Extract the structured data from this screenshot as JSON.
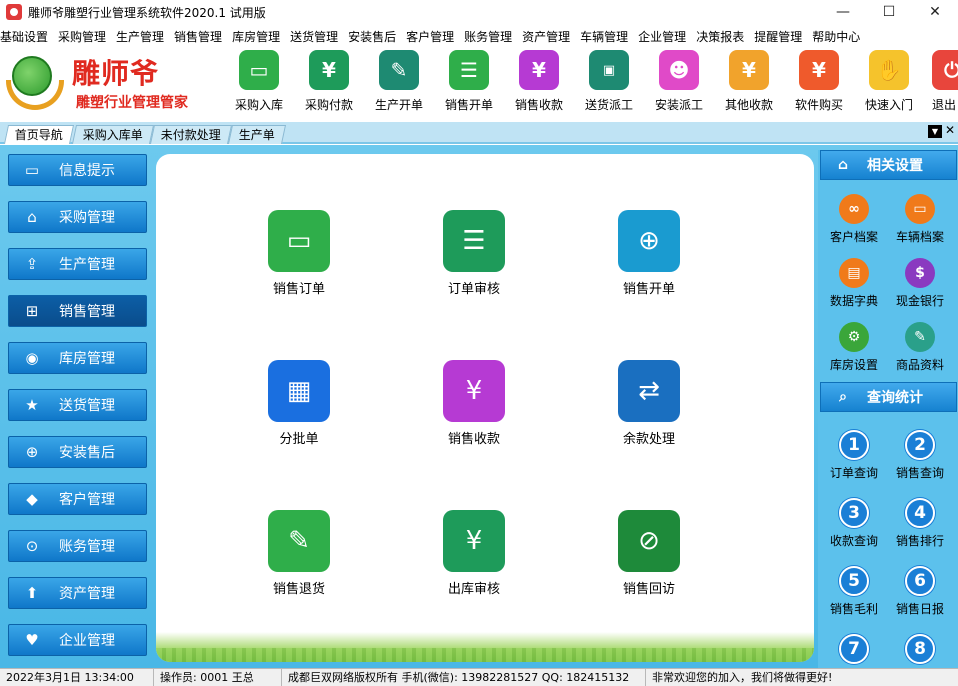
{
  "window": {
    "title": "雕师爷雕塑行业管理系统软件2020.1 试用版",
    "controls": {
      "minimize": "—",
      "maximize": "☐",
      "close": "✕"
    }
  },
  "menu": [
    "基础设置",
    "采购管理",
    "生产管理",
    "销售管理",
    "库房管理",
    "送货管理",
    "安装售后",
    "客户管理",
    "账务管理",
    "资产管理",
    "车辆管理",
    "企业管理",
    "决策报表",
    "提醒管理",
    "帮助中心"
  ],
  "logo": {
    "title": "雕师爷",
    "subtitle": "雕塑行业管理管家"
  },
  "toolbar": [
    {
      "label": "采购入库",
      "icon": "folder-icon",
      "color": "#2fae4a"
    },
    {
      "label": "采购付款",
      "icon": "scan-yen-icon",
      "color": "#1e9b5a"
    },
    {
      "label": "生产开单",
      "icon": "clipboard-pen-icon",
      "color": "#1e8a72"
    },
    {
      "label": "销售开单",
      "icon": "cart-form-icon",
      "color": "#2fae4a"
    },
    {
      "label": "销售收款",
      "icon": "receipt-yen-icon",
      "color": "#b63ad3"
    },
    {
      "label": "送货派工",
      "icon": "delivery-truck-icon",
      "color": "#1e8a72"
    },
    {
      "label": "安装派工",
      "icon": "people-icon",
      "color": "#e04ac8"
    },
    {
      "label": "其他收款",
      "icon": "money-bag-icon",
      "color": "#f1a32c"
    },
    {
      "label": "软件购买",
      "icon": "buy-yen-icon",
      "color": "#ef5a2c"
    },
    {
      "label": "快速入门",
      "icon": "hand-icon",
      "color": "#f5c32c"
    },
    {
      "label": "退出",
      "icon": "exit-icon",
      "color": "#e8453c"
    }
  ],
  "tabs": [
    "首页导航",
    "采购入库单",
    "未付款处理",
    "生产单"
  ],
  "leftnav": [
    {
      "label": "信息提示",
      "icon": "monitor-icon"
    },
    {
      "label": "采购管理",
      "icon": "home-icon"
    },
    {
      "label": "生产管理",
      "icon": "upload-box-icon"
    },
    {
      "label": "销售管理",
      "icon": "cart-icon"
    },
    {
      "label": "库房管理",
      "icon": "eye-icon"
    },
    {
      "label": "送货管理",
      "icon": "star-icon"
    },
    {
      "label": "安装售后",
      "icon": "target-icon"
    },
    {
      "label": "客户管理",
      "icon": "tag-icon"
    },
    {
      "label": "账务管理",
      "icon": "circle-plus-icon"
    },
    {
      "label": "资产管理",
      "icon": "upload-icon"
    },
    {
      "label": "企业管理",
      "icon": "heart-icon"
    }
  ],
  "center": [
    {
      "label": "销售订单",
      "icon": "folder-icon",
      "color": "#2fae4a"
    },
    {
      "label": "订单审核",
      "icon": "document-check-icon",
      "color": "#1e9b5a"
    },
    {
      "label": "销售开单",
      "icon": "sale-document-icon",
      "color": "#1a9bd0"
    },
    {
      "label": "分批单",
      "icon": "calendar-icon",
      "color": "#1a6fe0"
    },
    {
      "label": "销售收款",
      "icon": "receipt-yen-icon",
      "color": "#b63ad3"
    },
    {
      "label": "余款处理",
      "icon": "exchange-icon",
      "color": "#1a6fc0"
    },
    {
      "label": "销售退货",
      "icon": "edit-icon",
      "color": "#2fae4a"
    },
    {
      "label": "出库审核",
      "icon": "scan-yen-icon",
      "color": "#1e9b5a"
    },
    {
      "label": "销售回访",
      "icon": "pen-circle-icon",
      "color": "#1e8a3a"
    }
  ],
  "right": {
    "settings_title": "相关设置",
    "settings": [
      {
        "label": "客户档案",
        "icon": "link-icon",
        "color": "#f07a1a"
      },
      {
        "label": "车辆档案",
        "icon": "monitor-icon",
        "color": "#f07a1a"
      },
      {
        "label": "数据字典",
        "icon": "book-icon",
        "color": "#f07a1a"
      },
      {
        "label": "现金银行",
        "icon": "bank-icon",
        "color": "#8a3ac0"
      },
      {
        "label": "库房设置",
        "icon": "gear-icon",
        "color": "#3aa63a"
      },
      {
        "label": "商品资料",
        "icon": "pencil-icon",
        "color": "#2aa08a"
      }
    ],
    "stats_title": "查询统计",
    "stats": [
      {
        "num": "1",
        "label": "订单查询"
      },
      {
        "num": "2",
        "label": "销售查询"
      },
      {
        "num": "3",
        "label": "收款查询"
      },
      {
        "num": "4",
        "label": "销售排行"
      },
      {
        "num": "5",
        "label": "销售毛利"
      },
      {
        "num": "6",
        "label": "销售日报"
      },
      {
        "num": "7",
        "label": ""
      },
      {
        "num": "8",
        "label": ""
      }
    ]
  },
  "status": {
    "datetime": "2022年3月1日 13:34:00",
    "operator": "操作员: 0001 王总",
    "copyright": "成都巨双网络版权所有 手机(微信): 13982281527 QQ: 182415132",
    "message": "非常欢迎您的加入，我们将做得更好!"
  }
}
